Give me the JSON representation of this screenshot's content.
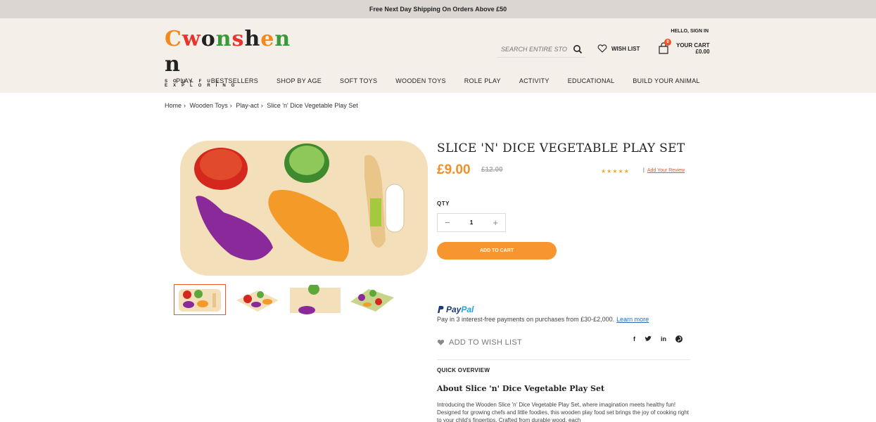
{
  "topbar": {
    "text": "Free Next Day Shipping On Orders Above £50"
  },
  "header": {
    "logo_text": "Cwonshenn",
    "logo_tagline": "SOULFUL EXPLORING",
    "hello": "HELLO, SIGN IN",
    "search_placeholder": "SEARCH ENTIRE STORE",
    "wishlist_label": "WISH LIST",
    "cart_count": "0",
    "cart_label": "YOUR CART",
    "cart_total": "£0.00"
  },
  "nav": [
    "PLAY",
    "BESTSELLERS",
    "SHOP BY AGE",
    "SOFT TOYS",
    "WOODEN TOYS",
    "ROLE PLAY",
    "ACTIVITY",
    "EDUCATIONAL",
    "BUILD YOUR ANIMAL"
  ],
  "breadcrumb": [
    "Home",
    "Wooden Toys",
    "Play-act",
    "Slice 'n' Dice Vegetable Play Set"
  ],
  "product": {
    "title": "SLICE 'N' DICE VEGETABLE PLAY SET",
    "price": "£9.00",
    "old_price": "£12.00",
    "stars": "★★★★★",
    "rating": 5,
    "review_sep": "|",
    "review_link": "Add Your Review",
    "qty_label": "QTY",
    "qty_value": "1",
    "add_to_cart": "ADD TO CART",
    "paypal_pay": "Pay",
    "paypal_pal": "Pal",
    "paypal_text": "Pay in 3 interest-free payments on purchases from £30-£2,000.",
    "paypal_link": "Learn more",
    "add_wishlist": "ADD TO WISH LIST",
    "social": [
      "f",
      "t",
      "in",
      "p"
    ],
    "quick_overview": "QUICK OVERVIEW",
    "about_title": "About Slice 'n' Dice Vegetable Play Set",
    "description": "Introducing the Wooden Slice 'n' Dice Vegetable Play Set, where imagination meets healthy fun! Designed for growing chefs and little foodies, this wooden play food set brings the joy of cooking right to your child's fingertips. Crafted from durable wood, each"
  },
  "colors": {
    "accent": "#f7962f",
    "header_bg": "#f5efe9",
    "topbar_bg": "#dcd6d2",
    "sale": "#e8562a"
  }
}
